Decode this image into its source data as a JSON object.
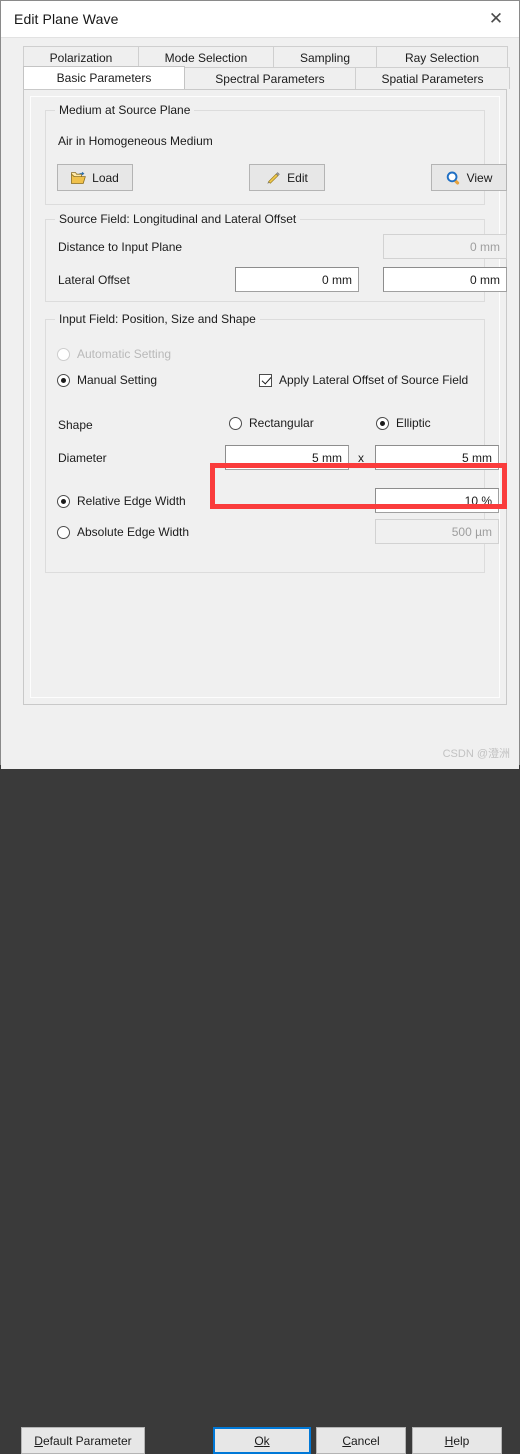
{
  "window": {
    "title": "Edit Plane Wave",
    "close_icon": "close-icon"
  },
  "tabs": {
    "row1": [
      {
        "label": "Polarization",
        "active": false
      },
      {
        "label": "Mode Selection",
        "active": false
      },
      {
        "label": "Sampling",
        "active": false
      },
      {
        "label": "Ray Selection",
        "active": false
      }
    ],
    "row2": [
      {
        "label": "Basic Parameters",
        "active": true
      },
      {
        "label": "Spectral Parameters",
        "active": false
      },
      {
        "label": "Spatial Parameters",
        "active": false
      }
    ]
  },
  "medium_group": {
    "title": "Medium at Source Plane",
    "value": "Air in Homogeneous Medium",
    "load_button": "Load",
    "edit_button": "Edit",
    "view_button": "View",
    "load_icon": "open-folder-icon",
    "edit_icon": "pencil-icon",
    "view_icon": "magnifier-icon"
  },
  "offset_group": {
    "title": "Source Field: Longitudinal and Lateral Offset",
    "distance_label": "Distance to Input Plane",
    "distance_value": "0 mm",
    "lateral_label": "Lateral Offset",
    "lateral_x_value": "0 mm",
    "lateral_y_value": "0 mm"
  },
  "input_field_group": {
    "title": "Input Field: Position, Size and Shape",
    "automatic_setting": "Automatic Setting",
    "manual_setting": "Manual Setting",
    "apply_lateral_offset": "Apply Lateral Offset of Source Field",
    "shape_label": "Shape",
    "shape_rectangular": "Rectangular",
    "shape_elliptic": "Elliptic",
    "diameter_label": "Diameter",
    "diameter_x_value": "5 mm",
    "diameter_separator": "x",
    "diameter_y_value": "5 mm",
    "relative_edge_width": "Relative Edge Width",
    "relative_edge_value": "10 %",
    "absolute_edge_width": "Absolute Edge Width",
    "absolute_edge_value": "500 µm"
  },
  "footer": {
    "default_parameter": {
      "mnemonic": "D",
      "rest": "efault Parameter"
    },
    "ok": {
      "pre": "O",
      "rest": "k"
    },
    "cancel": {
      "mnemonic": "C",
      "rest": "ancel"
    },
    "help": {
      "mnemonic": "H",
      "rest": "elp"
    },
    "watermark": "CSDN @澄洲"
  },
  "colors": {
    "accent": "#0078d7",
    "annotation": "#fa3c3c",
    "window_bg": "#f0f0f0"
  }
}
